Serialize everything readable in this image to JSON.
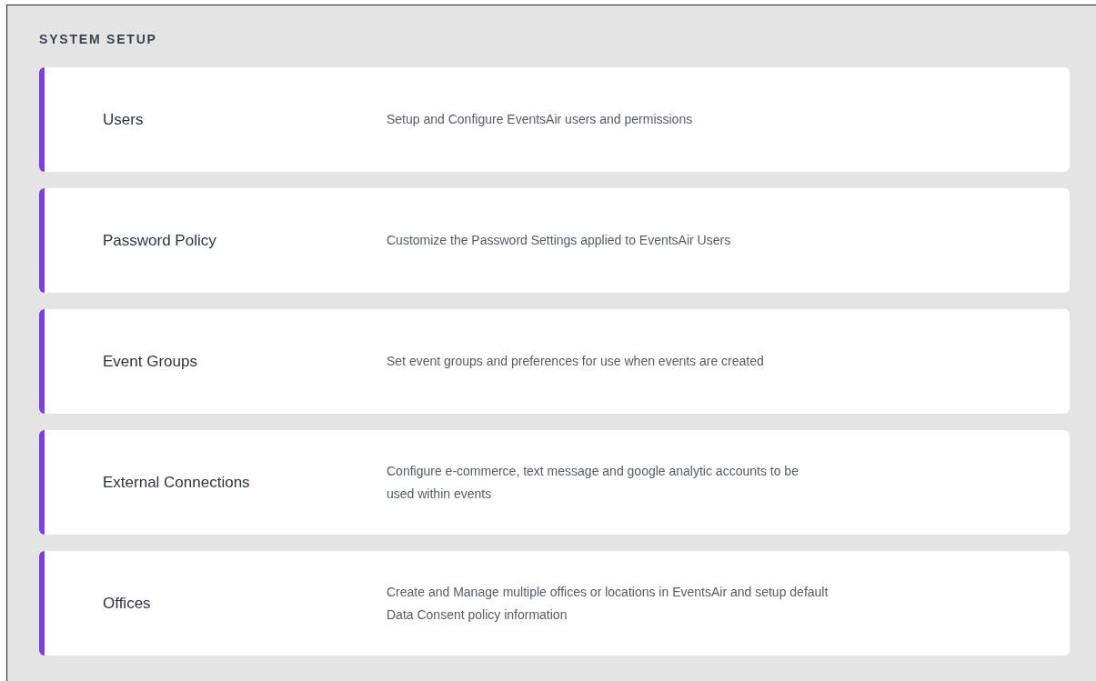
{
  "section": {
    "title": "SYSTEM SETUP"
  },
  "items": [
    {
      "title": "Users",
      "description_lines": [
        "Setup and Configure EventsAir users and permissions"
      ]
    },
    {
      "title": "Password Policy",
      "description_lines": [
        "Customize the Password Settings applied to EventsAir Users"
      ]
    },
    {
      "title": "Event Groups",
      "description_lines": [
        "Set event groups and preferences for use when events are created"
      ]
    },
    {
      "title": "External Connections",
      "description_lines": [
        "Configure e-commerce, text message and google analytic accounts to be",
        "used within events"
      ]
    },
    {
      "title": "Offices",
      "description_lines": [
        "Create and Manage multiple offices or locations in EventsAir and setup default",
        "Data Consent policy information"
      ]
    }
  ]
}
